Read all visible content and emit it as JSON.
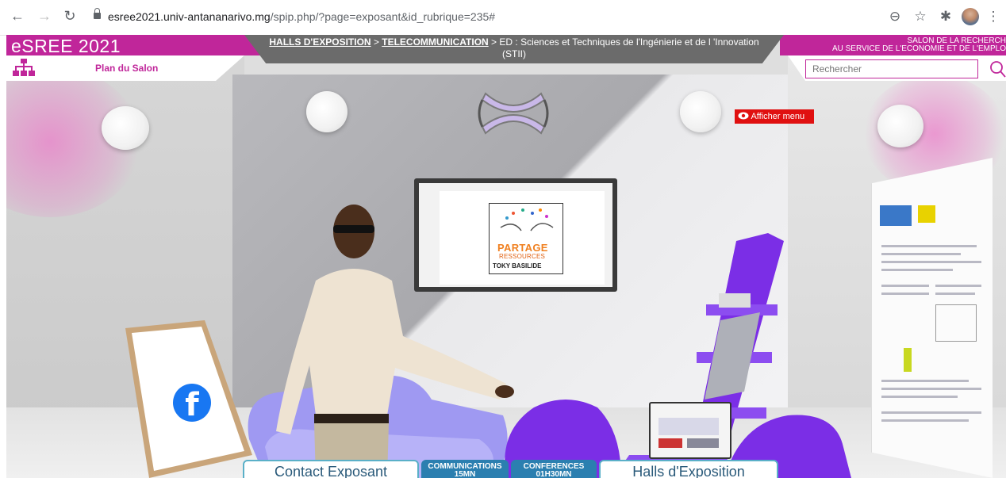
{
  "browser": {
    "url_host": "esree2021.univ-antananarivo.mg",
    "url_rest": "/spip.php/?page=exposant&id_rubrique=235#"
  },
  "site": {
    "logo": "eSREE 2021",
    "plan_label": "Plan du Salon",
    "slogan_line1": "SALON DE LA RECHERCH",
    "slogan_line2": "AU SERVICE DE L'ECONOMIE ET DE L'EMPLO",
    "search_placeholder": "Rechercher",
    "menu_button": "Afficher menu"
  },
  "breadcrumb": {
    "level1": "HALLS D'EXPOSITION",
    "sep1": " > ",
    "level2": "TELECOMMUNICATION",
    "sep2": " > ",
    "current": "ED : Sciences et Techniques de l'Ingénierie et de l 'Innovation (STII)"
  },
  "stand": {
    "screen_logo_line1": "PARTAGE",
    "screen_logo_line2": "RESSOURCES",
    "screen_logo_line3": "TOKY BASILIDE"
  },
  "bottom_nav": {
    "contact": "Contact Exposant",
    "communications_line1": "COMMUNICATIONS",
    "communications_line2": "15MN",
    "conferences_line1": "CONFERENCES",
    "conferences_line2": "01H30MN",
    "halls": "Halls d'Exposition"
  },
  "colors": {
    "brand": "#c0269a",
    "menu_button": "#e01010",
    "nav_accent": "#2b7fb0"
  }
}
